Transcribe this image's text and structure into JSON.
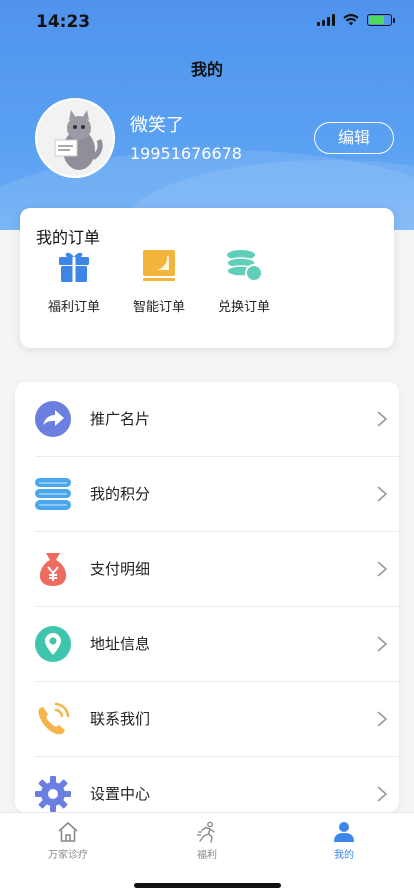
{
  "status_bar": {
    "time": "14:23"
  },
  "header": {
    "title": "我的"
  },
  "profile": {
    "username": "微笑了",
    "phone": "19951676678",
    "edit_label": "编辑",
    "avatar_icon": "cat-avatar-icon"
  },
  "orders": {
    "title": "我的订单",
    "items": [
      {
        "label": "福利订单",
        "icon": "gift-icon",
        "color": "#3d86e8"
      },
      {
        "label": "智能订单",
        "icon": "monitor-icon",
        "color": "#f2b43a"
      },
      {
        "label": "兑换订单",
        "icon": "coins-icon",
        "color": "#5fcfb9"
      }
    ]
  },
  "menu": {
    "items": [
      {
        "label": "推广名片",
        "icon": "share-arrow-icon",
        "color": "#6b7fe0"
      },
      {
        "label": "我的积分",
        "icon": "points-stack-icon",
        "color": "#4aa7ee"
      },
      {
        "label": "支付明细",
        "icon": "money-bag-icon",
        "color": "#ef6a5f"
      },
      {
        "label": "地址信息",
        "icon": "location-pin-icon",
        "color": "#3fc4ad"
      },
      {
        "label": "联系我们",
        "icon": "phone-icon",
        "color": "#f5b54a"
      },
      {
        "label": "设置中心",
        "icon": "settings-gear-icon",
        "color": "#6b7fe0"
      }
    ]
  },
  "tabbar": {
    "items": [
      {
        "label": "万家诊疗",
        "icon": "home-icon",
        "active": false
      },
      {
        "label": "福利",
        "icon": "runner-icon",
        "active": false
      },
      {
        "label": "我的",
        "icon": "user-icon",
        "active": true
      }
    ],
    "active_color": "#3d86e8",
    "inactive_color": "#8a8a8a"
  },
  "colors": {
    "header_blue": "#4f93ee"
  }
}
